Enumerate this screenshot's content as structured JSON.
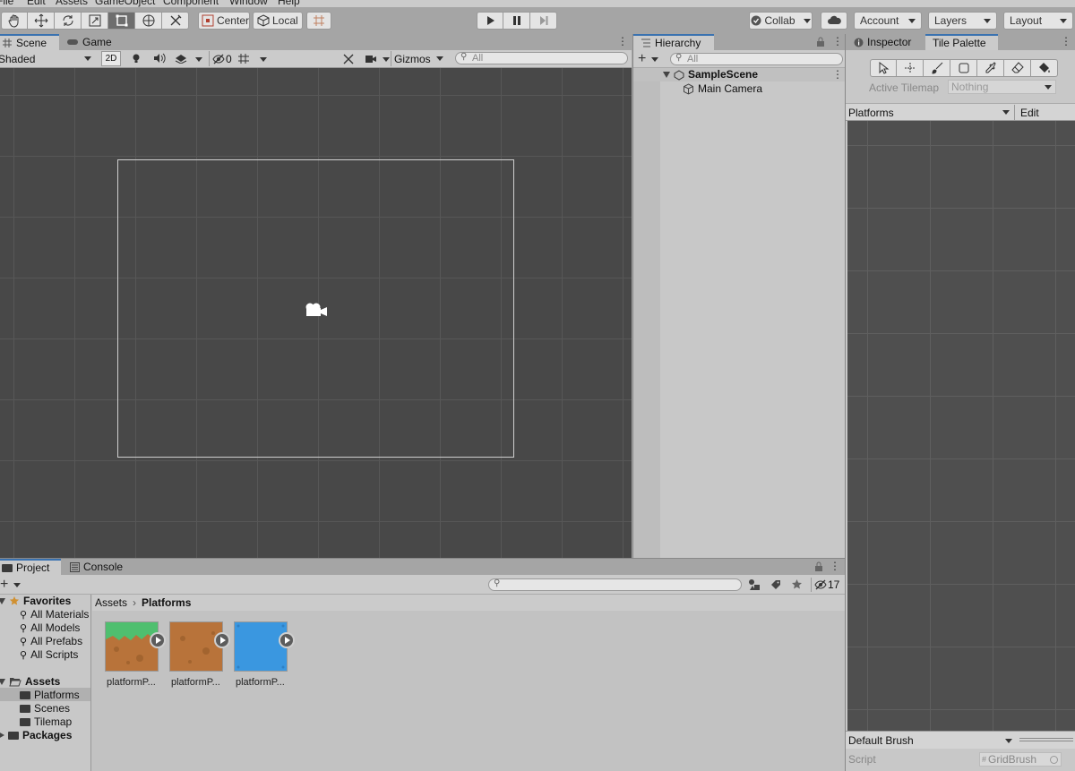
{
  "menu": [
    "File",
    "Edit",
    "Assets",
    "GameObject",
    "Component",
    "Window",
    "Help"
  ],
  "toolbar": {
    "pivot_mode": "Center",
    "pivot_rotation": "Local",
    "collab": "Collab",
    "account": "Account",
    "layers": "Layers",
    "layout": "Layout"
  },
  "scene": {
    "tabs": [
      "Scene",
      "Game"
    ],
    "shading_mode": "Shaded",
    "mode_2d": "2D",
    "hidden_count": "0",
    "gizmos": "Gizmos",
    "search_placeholder": "All"
  },
  "hierarchy": {
    "title": "Hierarchy",
    "search_placeholder": "All",
    "scene_name": "SampleScene",
    "items": [
      "Main Camera"
    ]
  },
  "inspector": {
    "tabs": [
      "Inspector",
      "Tile Palette"
    ],
    "active_tilemap_label": "Active Tilemap",
    "active_tilemap_value": "Nothing",
    "palette": "Platforms",
    "edit": "Edit",
    "brush": "Default Brush",
    "script_label": "Script",
    "script_value": "GridBrush"
  },
  "project": {
    "tabs": [
      "Project",
      "Console"
    ],
    "hidden_count": "17",
    "breadcrumb": [
      "Assets",
      "Platforms"
    ],
    "favorites_label": "Favorites",
    "favorites": [
      "All Materials",
      "All Models",
      "All Prefabs",
      "All Scripts"
    ],
    "assets_label": "Assets",
    "asset_folders": [
      "Platforms",
      "Scenes",
      "Tilemap"
    ],
    "packages_label": "Packages",
    "assets": [
      {
        "name": "platformP...",
        "color": "#b8733a",
        "top_color": "#4fbf6f"
      },
      {
        "name": "platformP...",
        "color": "#b8733a"
      },
      {
        "name": "platformP...",
        "color": "#3a97e0"
      }
    ]
  }
}
